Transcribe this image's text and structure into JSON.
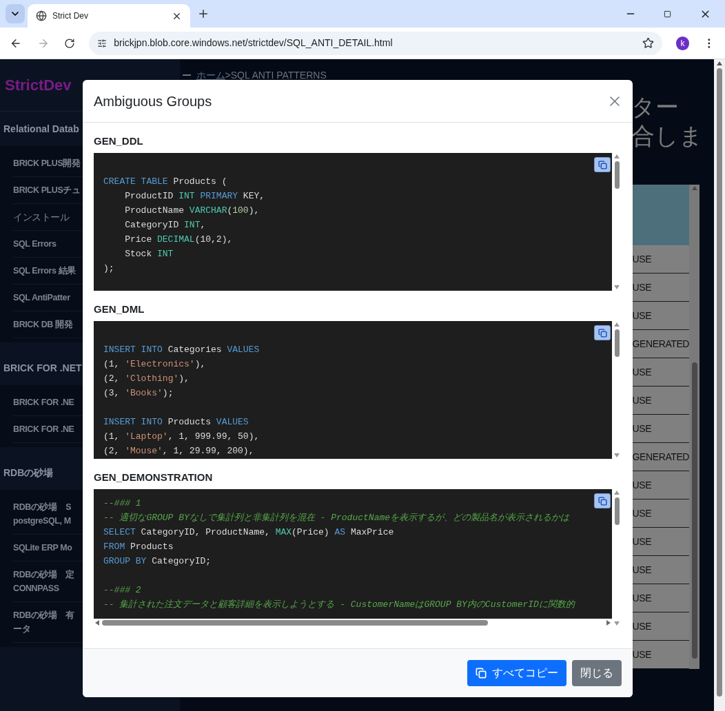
{
  "browser": {
    "tab_title": "Strict Dev",
    "url": "brickjpn.blob.core.windows.net/strictdev/SQL_ANTI_DETAIL.html",
    "profile_initial": "k"
  },
  "sidebar": {
    "brand": "StrictDev",
    "sections": [
      {
        "title": "Relational Datab",
        "items": [
          {
            "lines": [
              "BRICK PLUS開発"
            ]
          },
          {
            "lines": [
              "BRICK PLUSチュ"
            ]
          },
          {
            "lines": [
              "インストール"
            ],
            "bold": false
          },
          {
            "lines": [
              "SQL Errors"
            ]
          },
          {
            "lines": [
              "SQL Errors 結果"
            ]
          },
          {
            "lines": [
              "SQL AntiPatter"
            ]
          },
          {
            "lines": [
              "BRICK DB 開発"
            ]
          }
        ]
      },
      {
        "title": "BRICK FOR .NET",
        "items": [
          {
            "lines": [
              "BRICK FOR .NE"
            ]
          },
          {
            "lines": [
              "BRICK FOR .NE"
            ]
          }
        ]
      },
      {
        "title": "RDBの砂場",
        "items": [
          {
            "lines": [
              "RDBの砂場　S",
              "postgreSQL, M"
            ]
          },
          {
            "lines": [
              "SQLite ERP Mo"
            ]
          },
          {
            "lines": [
              "RDBの砂場　定",
              "CONNPASS"
            ]
          },
          {
            "lines": [
              "RDBの砂場　有",
              "ータ"
            ]
          }
        ]
      }
    ]
  },
  "page": {
    "breadcrumb_home": "ホーム",
    "breadcrumb_rest": ">SQL ANTI PATTERNS",
    "title_lines": [
      "ター",
      "合しま"
    ],
    "table_cells": [
      "USE",
      "USE",
      "USE",
      "GENERATED",
      "USE",
      "USE",
      "USE",
      "GENERATED",
      "USE",
      "USE",
      "USE",
      "USE",
      "USE",
      "USE",
      "USE"
    ]
  },
  "modal": {
    "title": "Ambiguous Groups",
    "sections": [
      {
        "label": "GEN_DDL",
        "horizontal_scroll": false,
        "lines": [
          {
            "gap_before": true,
            "tokens": [
              {
                "kind": "keyword",
                "text": "CREATE TABLE"
              },
              {
                "kind": "plain",
                "text": " Products ("
              }
            ]
          },
          {
            "gap_before": false,
            "tokens": [
              {
                "kind": "plain",
                "text": "    ProductID "
              },
              {
                "kind": "type",
                "text": "INT"
              },
              {
                "kind": "keyword",
                "text": " PRIMARY"
              },
              {
                "kind": "plain",
                "text": " KEY,"
              }
            ]
          },
          {
            "gap_before": false,
            "tokens": [
              {
                "kind": "plain",
                "text": "    ProductName "
              },
              {
                "kind": "type",
                "text": "VARCHAR"
              },
              {
                "kind": "plain",
                "text": "("
              },
              {
                "kind": "number",
                "text": "100"
              },
              {
                "kind": "plain",
                "text": "),"
              }
            ]
          },
          {
            "gap_before": false,
            "tokens": [
              {
                "kind": "plain",
                "text": "    CategoryID "
              },
              {
                "kind": "type",
                "text": "INT"
              },
              {
                "kind": "plain",
                "text": ","
              }
            ]
          },
          {
            "gap_before": false,
            "tokens": [
              {
                "kind": "plain",
                "text": "    Price "
              },
              {
                "kind": "type",
                "text": "DECIMAL"
              },
              {
                "kind": "plain",
                "text": "(10,2),"
              }
            ]
          },
          {
            "gap_before": false,
            "tokens": [
              {
                "kind": "plain",
                "text": "    Stock "
              },
              {
                "kind": "type",
                "text": "INT"
              }
            ]
          },
          {
            "gap_before": false,
            "tokens": [
              {
                "kind": "plain",
                "text": ");"
              }
            ]
          }
        ]
      },
      {
        "label": "GEN_DML",
        "horizontal_scroll": false,
        "lines": [
          {
            "gap_before": true,
            "tokens": [
              {
                "kind": "keyword",
                "text": "INSERT INTO"
              },
              {
                "kind": "plain",
                "text": " Categories "
              },
              {
                "kind": "keyword",
                "text": "VALUES"
              }
            ]
          },
          {
            "gap_before": false,
            "tokens": [
              {
                "kind": "plain",
                "text": "(1, "
              },
              {
                "kind": "string",
                "text": "'Electronics'"
              },
              {
                "kind": "plain",
                "text": "),"
              }
            ]
          },
          {
            "gap_before": false,
            "tokens": [
              {
                "kind": "plain",
                "text": "(2, "
              },
              {
                "kind": "string",
                "text": "'Clothing'"
              },
              {
                "kind": "plain",
                "text": "),"
              }
            ]
          },
          {
            "gap_before": false,
            "tokens": [
              {
                "kind": "plain",
                "text": "(3, "
              },
              {
                "kind": "string",
                "text": "'Books'"
              },
              {
                "kind": "plain",
                "text": ");"
              }
            ]
          },
          {
            "gap_before": true,
            "tokens": [
              {
                "kind": "keyword",
                "text": "INSERT INTO"
              },
              {
                "kind": "plain",
                "text": " Products "
              },
              {
                "kind": "keyword",
                "text": "VALUES"
              }
            ]
          },
          {
            "gap_before": false,
            "tokens": [
              {
                "kind": "plain",
                "text": "(1, "
              },
              {
                "kind": "string",
                "text": "'Laptop'"
              },
              {
                "kind": "plain",
                "text": ", 1, 999.99, 50),"
              }
            ]
          },
          {
            "gap_before": false,
            "tokens": [
              {
                "kind": "plain",
                "text": "(2, "
              },
              {
                "kind": "string",
                "text": "'Mouse'"
              },
              {
                "kind": "plain",
                "text": ", 1, 29.99, 200),"
              }
            ]
          }
        ]
      },
      {
        "label": "GEN_DEMONSTRATION",
        "horizontal_scroll": true,
        "lines": [
          {
            "gap_before": false,
            "tokens": [
              {
                "kind": "comment",
                "text": "--### 1"
              }
            ]
          },
          {
            "gap_before": false,
            "tokens": [
              {
                "kind": "comment",
                "text": "-- 適切なGROUP BYなしで集計列と非集計列を混在 - ProductNameを表示するが、どの製品名が表示されるかは"
              }
            ]
          },
          {
            "gap_before": false,
            "tokens": [
              {
                "kind": "keyword",
                "text": "SELECT"
              },
              {
                "kind": "plain",
                "text": " CategoryID, ProductName, "
              },
              {
                "kind": "type",
                "text": "MAX"
              },
              {
                "kind": "plain",
                "text": "(Price) "
              },
              {
                "kind": "keyword",
                "text": "AS"
              },
              {
                "kind": "plain",
                "text": " MaxPrice"
              }
            ]
          },
          {
            "gap_before": false,
            "tokens": [
              {
                "kind": "keyword",
                "text": "FROM"
              },
              {
                "kind": "plain",
                "text": " Products"
              }
            ]
          },
          {
            "gap_before": false,
            "tokens": [
              {
                "kind": "keyword",
                "text": "GROUP BY"
              },
              {
                "kind": "plain",
                "text": " CategoryID;"
              }
            ]
          },
          {
            "gap_before": true,
            "tokens": [
              {
                "kind": "comment",
                "text": "--### 2"
              }
            ]
          },
          {
            "gap_before": false,
            "tokens": [
              {
                "kind": "comment",
                "text": "-- 集計された注文データと顧客詳細を表示しようとする - CustomerNameはGROUP BY内のCustomerIDに関数的"
              }
            ]
          }
        ]
      }
    ],
    "buttons": [
      {
        "kind": "primary",
        "label": "すべてコピー"
      },
      {
        "kind": "secondary",
        "label": "閉じる"
      }
    ]
  }
}
